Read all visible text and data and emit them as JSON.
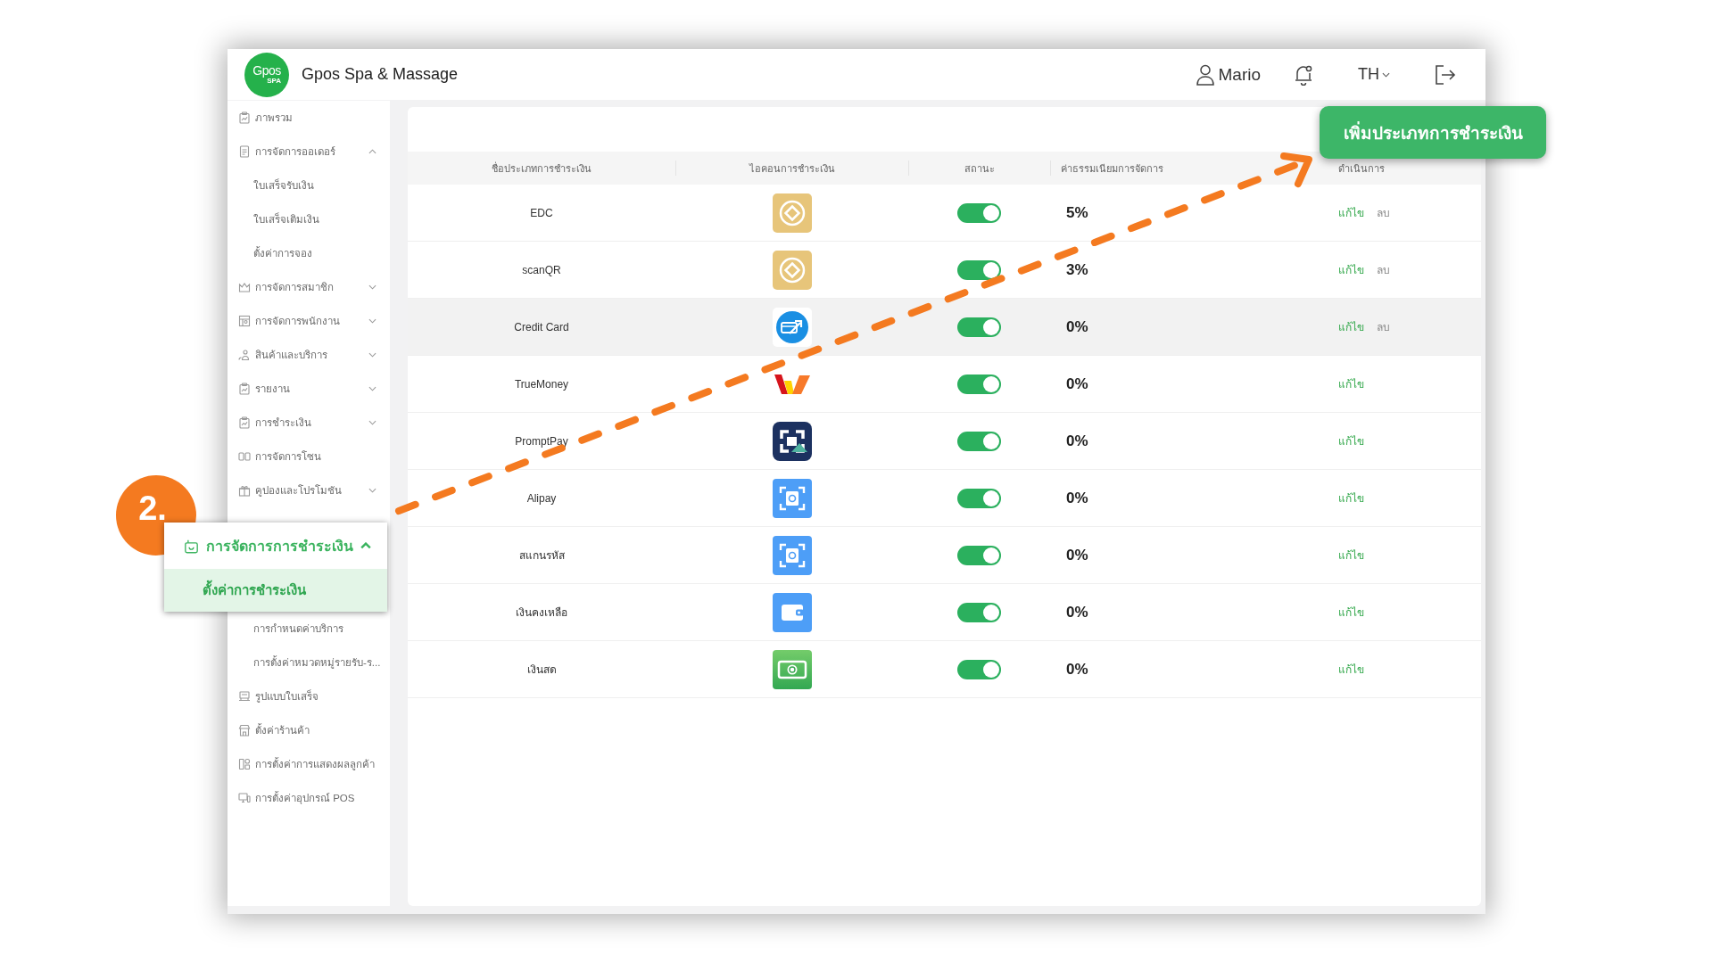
{
  "header": {
    "logo": {
      "wordmark": "Gpos",
      "tagline": "SPA"
    },
    "title": "Gpos Spa & Massage",
    "user": "Mario",
    "language": "TH"
  },
  "sidebar": {
    "items": [
      {
        "kind": "link",
        "label": "ภาพรวม",
        "selected": false
      },
      {
        "kind": "group",
        "label": "การจัดการออเดอร์",
        "expanded": true,
        "children": [
          {
            "label": "ใบเสร็จรับเงิน",
            "selected": false
          },
          {
            "label": "ใบเสร็จเติมเงิน",
            "selected": false
          },
          {
            "label": "ตั้งค่าการจอง",
            "selected": false
          }
        ]
      },
      {
        "kind": "group",
        "label": "การจัดการสมาชิก",
        "expanded": false
      },
      {
        "kind": "group",
        "label": "การจัดการพนักงาน",
        "expanded": false
      },
      {
        "kind": "group",
        "label": "สินค้าและบริการ",
        "expanded": false
      },
      {
        "kind": "group",
        "label": "รายงาน",
        "expanded": false
      },
      {
        "kind": "group",
        "label": "การชำระเงิน",
        "expanded": false
      },
      {
        "kind": "link",
        "label": "การจัดการโซน",
        "selected": false
      },
      {
        "kind": "group",
        "label": "คูปองและโปรโมชัน",
        "expanded": false
      },
      {
        "kind": "callout",
        "label": "การจัดการการชำระเงิน",
        "expanded": true,
        "children": [
          {
            "label": "ตั้งค่าการชำระเงิน",
            "selected": true
          },
          {
            "label": "การกำหนดค่าบริการ",
            "selected": false
          },
          {
            "label": "การตั้งค่าหมวดหมู่รายรับ-ร...",
            "selected": false
          }
        ]
      },
      {
        "kind": "link",
        "label": "รูปแบบใบเสร็จ",
        "selected": false
      },
      {
        "kind": "link",
        "label": "ตั้งค่าร้านค้า",
        "selected": false
      },
      {
        "kind": "link",
        "label": "การตั้งค่าการแสดงผลลูกค้า",
        "selected": false
      },
      {
        "kind": "link",
        "label": "การตั้งค่าอุปกรณ์ POS",
        "selected": false
      }
    ]
  },
  "step_badge": "2.",
  "add_button": "เพิ่มประเภทการชำระเงิน",
  "table": {
    "columns": [
      "ชื่อประเภทการชำระเงิน",
      "ไอคอนการชำระเงิน",
      "สถานะ",
      "ค่าธรรมเนียมการจัดการ",
      "ดำเนินการ"
    ],
    "rows": [
      {
        "name": "EDC",
        "on": true,
        "fee": "5%",
        "highlighted": false,
        "actions": [
          {
            "kind": "edit",
            "label": "แก้ไข"
          },
          {
            "kind": "delete",
            "label": "ลบ"
          }
        ]
      },
      {
        "name": "scanQR",
        "on": true,
        "fee": "3%",
        "highlighted": false,
        "actions": [
          {
            "kind": "edit",
            "label": "แก้ไข"
          },
          {
            "kind": "delete",
            "label": "ลบ"
          }
        ]
      },
      {
        "name": "Credit Card",
        "on": true,
        "fee": "0%",
        "highlighted": true,
        "actions": [
          {
            "kind": "edit",
            "label": "แก้ไข"
          },
          {
            "kind": "delete",
            "label": "ลบ"
          }
        ]
      },
      {
        "name": "TrueMoney",
        "on": true,
        "fee": "0%",
        "highlighted": false,
        "actions": [
          {
            "kind": "edit",
            "label": "แก้ไข"
          }
        ]
      },
      {
        "name": "PromptPay",
        "on": true,
        "fee": "0%",
        "highlighted": false,
        "actions": [
          {
            "kind": "edit",
            "label": "แก้ไข"
          }
        ]
      },
      {
        "name": "Alipay",
        "on": true,
        "fee": "0%",
        "highlighted": false,
        "actions": [
          {
            "kind": "edit",
            "label": "แก้ไข"
          }
        ]
      },
      {
        "name": "สแกนรหัส",
        "on": true,
        "fee": "0%",
        "highlighted": false,
        "actions": [
          {
            "kind": "edit",
            "label": "แก้ไข"
          }
        ]
      },
      {
        "name": "เงินคงเหลือ",
        "on": true,
        "fee": "0%",
        "highlighted": false,
        "actions": [
          {
            "kind": "edit",
            "label": "แก้ไข"
          }
        ]
      },
      {
        "name": "เงินสด",
        "on": true,
        "fee": "0%",
        "highlighted": false,
        "actions": [
          {
            "kind": "edit",
            "label": "แก้ไข"
          }
        ]
      }
    ]
  }
}
